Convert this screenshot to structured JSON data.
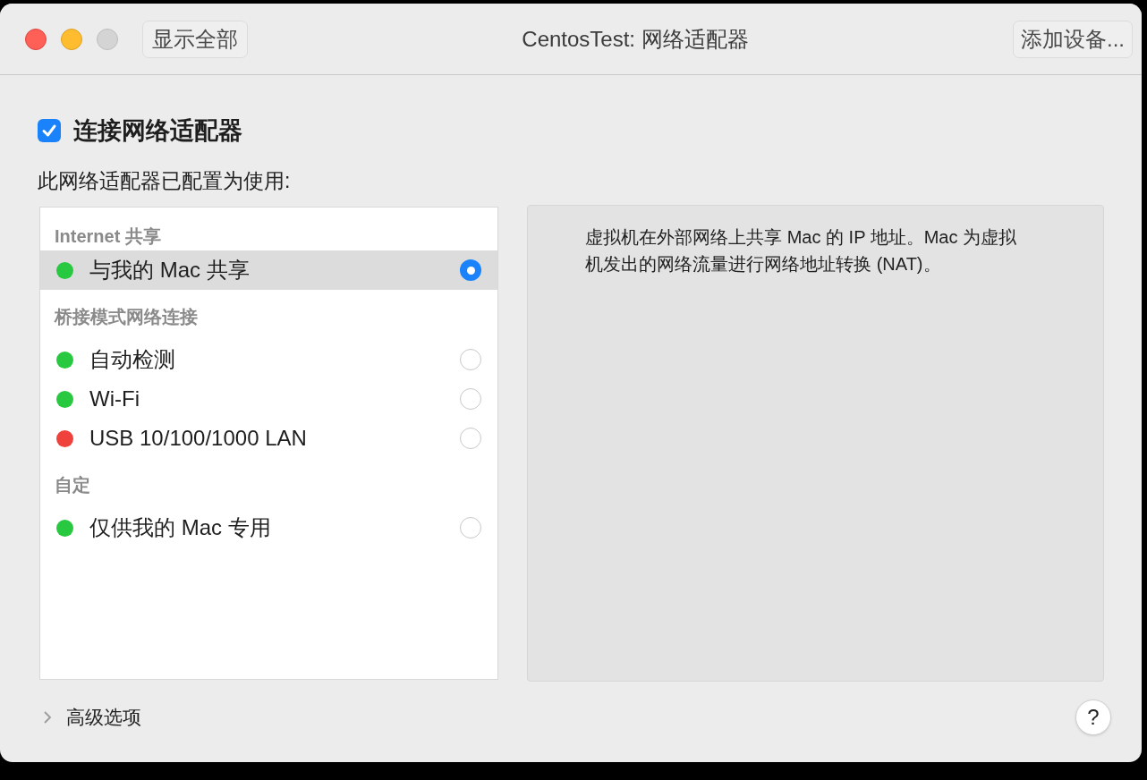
{
  "window": {
    "title": "CentosTest: 网络适配器"
  },
  "toolbar": {
    "left_button": "显示全部",
    "right_button": "添加设备..."
  },
  "connect": {
    "label": "连接网络适配器",
    "checked": true
  },
  "subtitle": "此网络适配器已配置为使用:",
  "sections": [
    {
      "heading": "Internet 共享",
      "items": [
        {
          "label": "与我的 Mac 共享",
          "color": "#28c840",
          "selected": true
        }
      ]
    },
    {
      "heading": "桥接模式网络连接",
      "items": [
        {
          "label": "自动检测",
          "color": "#28c840",
          "selected": false
        },
        {
          "label": "Wi-Fi",
          "color": "#28c840",
          "selected": false
        },
        {
          "label": "USB 10/100/1000 LAN",
          "color": "#f0423c",
          "selected": false
        }
      ]
    },
    {
      "heading": "自定",
      "items": [
        {
          "label": "仅供我的 Mac 专用",
          "color": "#28c840",
          "selected": false
        }
      ]
    }
  ],
  "description": "虚拟机在外部网络上共享 Mac 的 IP 地址。Mac 为虚拟机发出的网络流量进行网络地址转换 (NAT)。",
  "advanced": {
    "label": "高级选项",
    "expanded": false
  },
  "help_button": "?"
}
